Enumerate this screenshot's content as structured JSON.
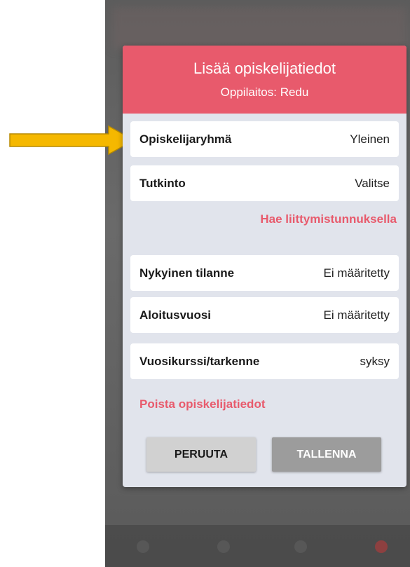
{
  "dialog": {
    "title": "Lisää opiskelijatiedot",
    "subtitle": "Oppilaitos: Redu"
  },
  "rows": [
    {
      "label": "Opiskelijaryhmä",
      "value": "Yleinen"
    },
    {
      "label": "Tutkinto",
      "value": "Valitse"
    },
    {
      "label": "Nykyinen tilanne",
      "value": "Ei määritetty"
    },
    {
      "label": "Aloitusvuosi",
      "value": "Ei määritetty"
    },
    {
      "label": "Vuosikurssi/tarkenne",
      "value": "syksy"
    }
  ],
  "links": {
    "join_code": "Hae liittymistunnuksella",
    "delete": "Poista opiskelijatiedot"
  },
  "buttons": {
    "cancel": "PERUUTA",
    "save": "TALLENNA"
  },
  "colors": {
    "accent": "#e85a6c",
    "dialog_bg": "#e1e4ec",
    "arrow": "#f5b800"
  }
}
